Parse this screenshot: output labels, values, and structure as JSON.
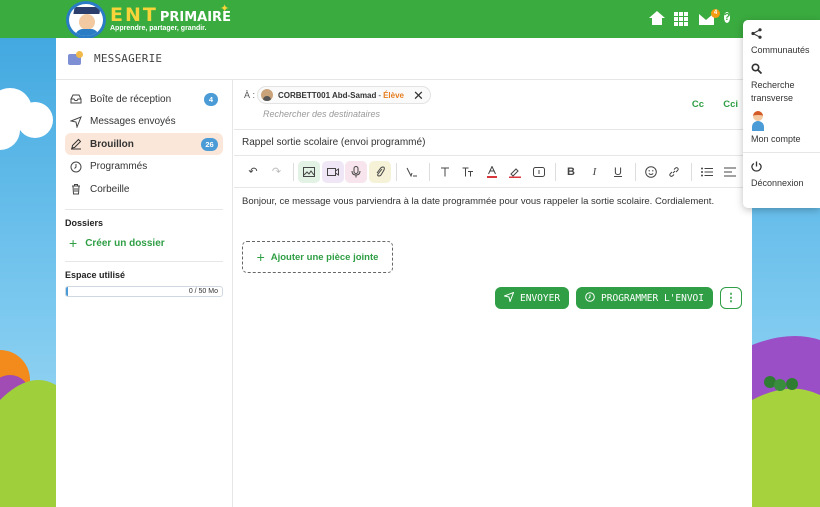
{
  "brand": {
    "name_part1": "ENT",
    "name_part2": "PRIMAIRE",
    "tagline": "Apprendre, partager, grandir."
  },
  "topbar": {
    "mail_count": "4",
    "help_label": "?"
  },
  "header": {
    "title": "MESSAGERIE"
  },
  "sidebar": {
    "items": [
      {
        "label": "Boîte de réception",
        "badge": "4"
      },
      {
        "label": "Messages envoyés"
      },
      {
        "label": "Brouillon",
        "badge": "26"
      },
      {
        "label": "Programmés"
      },
      {
        "label": "Corbeille"
      }
    ],
    "folders_title": "Dossiers",
    "create_folder": "Créer un dossier",
    "storage_title": "Espace utilisé",
    "storage_text": "0 / 50 Mo",
    "storage_fraction": 0.01
  },
  "compose": {
    "to_label": "À :",
    "recipient": {
      "name": "CORBETT001 Abd-Samad",
      "separator": "-",
      "role": "Élève"
    },
    "recipient_placeholder": "Rechercher des destinataires",
    "cc": "Cc",
    "cci": "Cci",
    "subject": "Rappel sortie scolaire (envoi programmé)",
    "body": "Bonjour, ce message vous parviendra à la date programmée pour vous rappeler la sortie scolaire. Cordialement.",
    "attach_label": "Ajouter une pièce jointe",
    "send_label": "ENVOYER",
    "schedule_label": "PROGRAMMER L'ENVOI"
  },
  "menu": {
    "items": [
      {
        "label": "Communautés",
        "icon": "share-icon"
      },
      {
        "label": "Recherche transverse",
        "icon": "search-icon"
      },
      {
        "label": "Mon compte",
        "icon": "avatar-icon"
      },
      {
        "label": "Déconnexion",
        "icon": "power-icon"
      }
    ]
  },
  "colors": {
    "brand_green": "#3aab3f",
    "action_green": "#2f9e44",
    "badge_blue": "#4a9bd6",
    "role_orange": "#e67e22",
    "active_bg": "#fbe7d9"
  }
}
